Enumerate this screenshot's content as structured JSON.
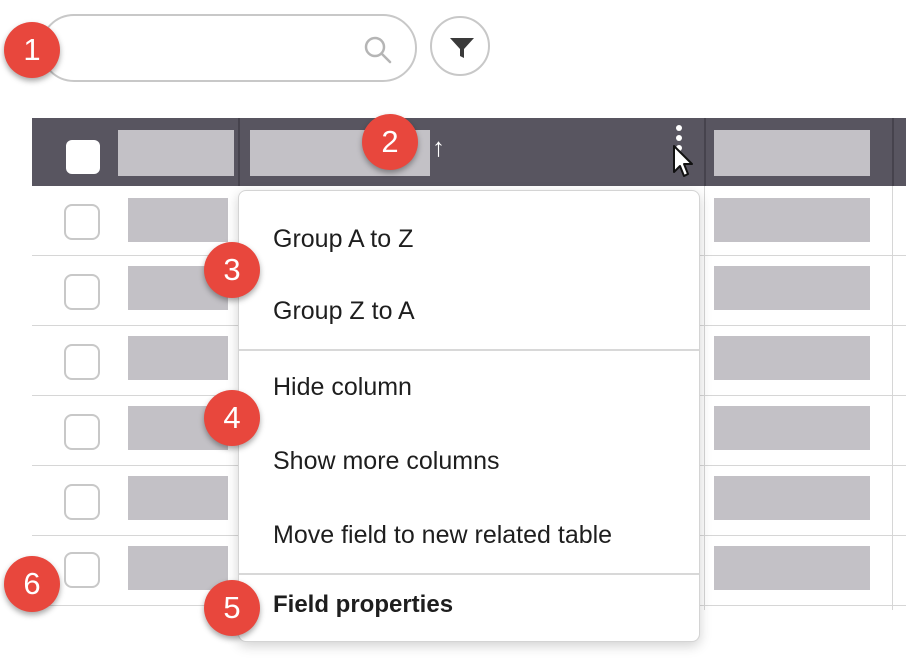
{
  "search": {
    "value": "",
    "placeholder": ""
  },
  "table": {
    "sort_arrow": "↑",
    "row_count": 6
  },
  "menu": {
    "items": [
      {
        "label": "Group A to Z"
      },
      {
        "label": "Group Z to A"
      },
      {
        "label": "Hide column"
      },
      {
        "label": "Show more columns"
      },
      {
        "label": "Move field to new related table"
      },
      {
        "label": "Field properties"
      }
    ]
  },
  "badges": [
    "1",
    "2",
    "3",
    "4",
    "5",
    "6"
  ],
  "colors": {
    "header_bg": "#585560",
    "badge": "#e8473d",
    "placeholder": "#c3c1c6"
  },
  "icons": [
    "search-icon",
    "filter-icon",
    "sort-ascending-icon",
    "kebab-menu-icon",
    "mouse-pointer-icon"
  ]
}
